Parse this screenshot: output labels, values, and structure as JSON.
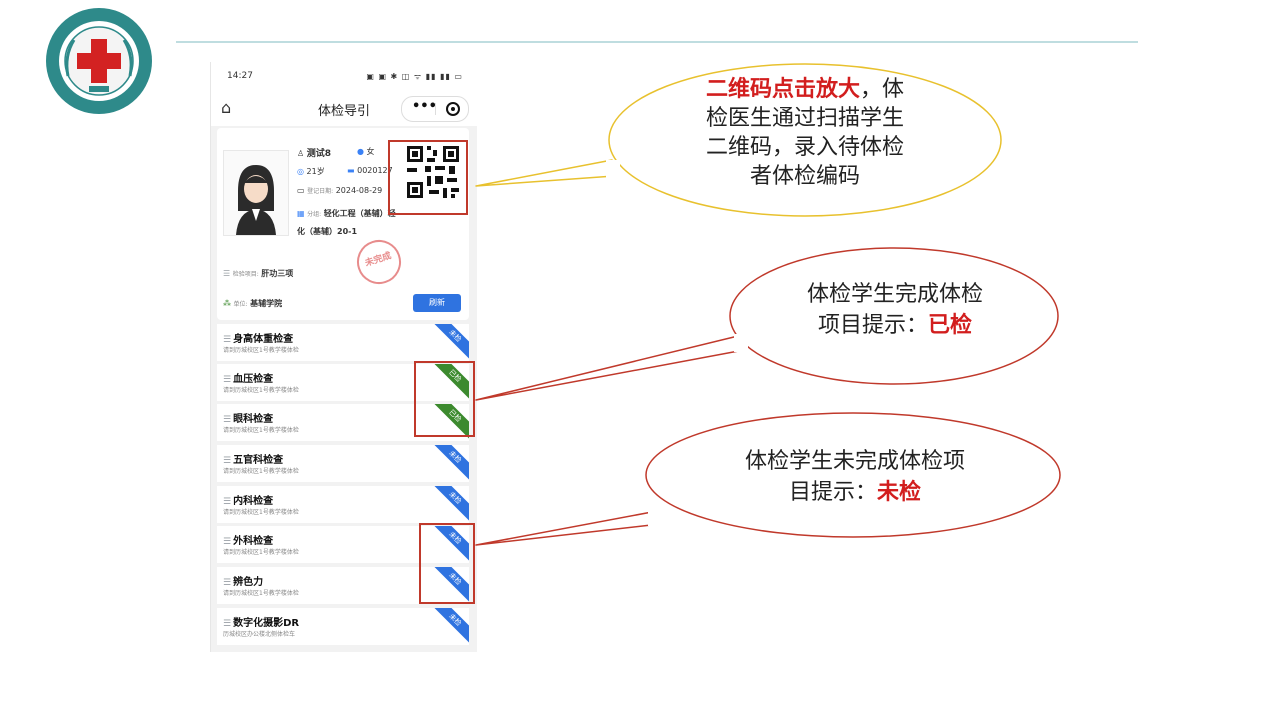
{
  "phone": {
    "status_time": "14:27",
    "status_icons": "▣ ▣ ✱ ◫ ᯤ ▮▮ ▮▮ ▭",
    "nav_title": "体检导引"
  },
  "profile": {
    "name": "测试8",
    "gender": "女",
    "age": "21岁",
    "exam_no": "0020127",
    "reg_date_label": "登记日期:",
    "reg_date": "2024-08-29",
    "group_label": "分组:",
    "group": "轻化工程（基辅）轻",
    "group_line2": "化（基辅）20-1",
    "stamp": "未完成",
    "project_label": "检验项目:",
    "project": "肝功三项",
    "unit_label": "单位:",
    "unit": "基辅学院",
    "refresh": "刷新"
  },
  "items": [
    {
      "name": "身高体重检查",
      "loc": "请到历城校区1号教学楼体检",
      "status": "未检"
    },
    {
      "name": "血压检查",
      "loc": "请到历城校区1号教学楼体检",
      "status": "已检"
    },
    {
      "name": "眼科检查",
      "loc": "请到历城校区1号教学楼体检",
      "status": "已检"
    },
    {
      "name": "五官科检查",
      "loc": "请到历城校区1号教学楼体检",
      "status": "未检"
    },
    {
      "name": "内科检查",
      "loc": "请到历城校区1号教学楼体检",
      "status": "未检"
    },
    {
      "name": "外科检查",
      "loc": "请到历城校区1号教学楼体检",
      "status": "未检"
    },
    {
      "name": "辨色力",
      "loc": "请到历城校区1号教学楼体检",
      "status": "未检"
    },
    {
      "name": "数字化摄影DR",
      "loc": "历城校区办公楼北侧体检车",
      "status": "未检"
    }
  ],
  "callouts": {
    "qr_red": "二维码点击放大",
    "qr_rest_1": "，体",
    "qr_line2": "检医生通过扫描学生",
    "qr_line3": "二维码，录入待体检",
    "qr_line4": "者体检编码",
    "done_line1": "体检学生完成体检",
    "done_line2": "项目提示：",
    "done_red": "已检",
    "undone_line1": "体检学生未完成体检项",
    "undone_line2": "目提示：",
    "undone_red": "未检"
  },
  "colors": {
    "accent": "#2f73e0",
    "done": "#3c8a2e",
    "highlight": "#c0392b",
    "callout_red": "#d21e1e"
  }
}
